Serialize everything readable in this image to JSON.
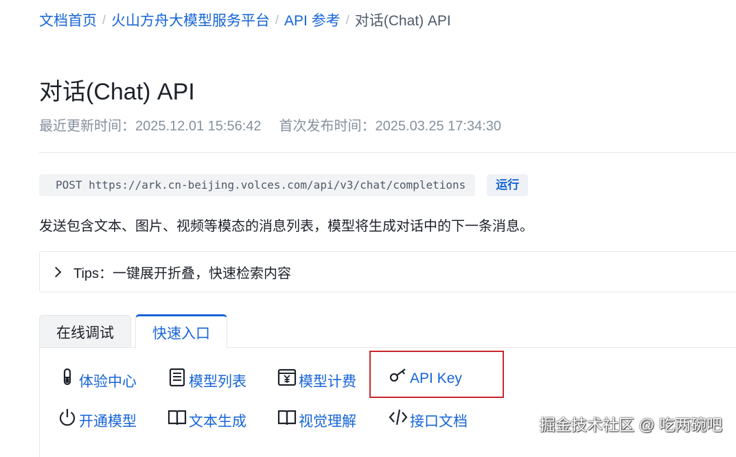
{
  "breadcrumb": {
    "items": [
      "文档首页",
      "火山方舟大模型服务平台",
      "API 参考"
    ],
    "separator": "/",
    "current": "对话(Chat) API"
  },
  "page": {
    "title": "对话(Chat) API",
    "updated": "最近更新时间：2025.12.01 15:56:42",
    "published": "首次发布时间：2025.03.25 17:34:30"
  },
  "endpoint": {
    "code": "POST https://ark.cn-beijing.volces.com/api/v3/chat/completions",
    "run_label": "运行"
  },
  "description": "发送包含文本、图片、视频等模态的消息列表，模型将生成对话中的下一条消息。",
  "tips": {
    "label": "Tips：一键展开折叠，快速检索内容"
  },
  "tabs": [
    {
      "label": "在线调试",
      "active": false
    },
    {
      "label": "快速入口",
      "active": true
    }
  ],
  "quick_links": [
    {
      "label": "体验中心",
      "icon": "test-tube-icon"
    },
    {
      "label": "模型列表",
      "icon": "list-icon"
    },
    {
      "label": "模型计费",
      "icon": "billing-icon"
    },
    {
      "label": "API Key",
      "icon": "key-icon"
    },
    {
      "label": "开通模型",
      "icon": "power-icon"
    },
    {
      "label": "文本生成",
      "icon": "book-icon"
    },
    {
      "label": "视觉理解",
      "icon": "book-icon"
    },
    {
      "label": "接口文档",
      "icon": "code-icon"
    }
  ],
  "watermark": "掘金技术社区 @ 吃两碗吧",
  "colors": {
    "link": "#1664d8",
    "highlight": "#c8262b",
    "text": "#1d2129",
    "muted": "#86909c"
  }
}
